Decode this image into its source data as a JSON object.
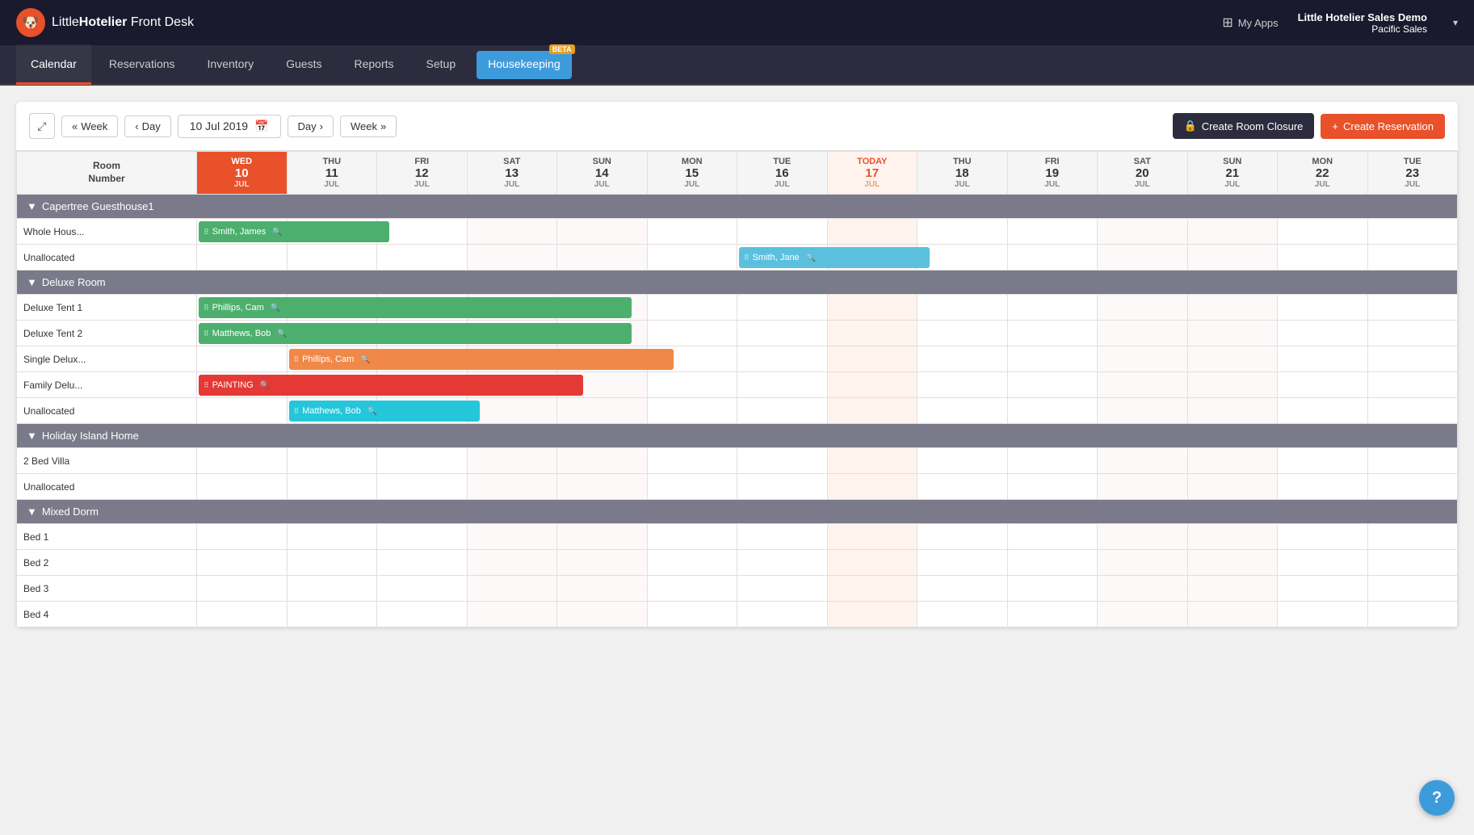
{
  "app": {
    "logo_text_light": "Little",
    "logo_text_bold": "Hotelier",
    "logo_subtext": "Front Desk",
    "logo_emoji": "🐶"
  },
  "nav_right": {
    "my_apps_label": "My Apps",
    "user_name": "Little Hotelier Sales Demo",
    "user_sub": "Pacific Sales"
  },
  "tabs": [
    {
      "label": "Calendar",
      "active": true
    },
    {
      "label": "Reservations",
      "active": false
    },
    {
      "label": "Inventory",
      "active": false
    },
    {
      "label": "Guests",
      "active": false
    },
    {
      "label": "Reports",
      "active": false
    },
    {
      "label": "Setup",
      "active": false
    },
    {
      "label": "Housekeeping",
      "active": false,
      "beta": true
    }
  ],
  "toolbar": {
    "week_back_label": "« Week",
    "day_back_label": "‹ Day",
    "current_date": "10 Jul 2019",
    "day_fwd_label": "Day »",
    "week_fwd_label": "Week »",
    "room_closure_label": "Create Room Closure",
    "create_reservation_label": "Create Reservation"
  },
  "calendar": {
    "room_number_header": "Room\nNumber",
    "days": [
      {
        "name": "WED",
        "num": "10",
        "month": "JUL",
        "type": "selected"
      },
      {
        "name": "THU",
        "num": "11",
        "month": "JUL",
        "type": "normal"
      },
      {
        "name": "FRI",
        "num": "12",
        "month": "JUL",
        "type": "normal"
      },
      {
        "name": "SAT",
        "num": "13",
        "month": "JUL",
        "type": "weekend"
      },
      {
        "name": "SUN",
        "num": "14",
        "month": "JUL",
        "type": "weekend"
      },
      {
        "name": "MON",
        "num": "15",
        "month": "JUL",
        "type": "normal"
      },
      {
        "name": "TUE",
        "num": "16",
        "month": "JUL",
        "type": "normal"
      },
      {
        "name": "TODAY",
        "num": "17",
        "month": "JUL",
        "type": "today"
      },
      {
        "name": "THU",
        "num": "18",
        "month": "JUL",
        "type": "normal"
      },
      {
        "name": "FRI",
        "num": "19",
        "month": "JUL",
        "type": "normal"
      },
      {
        "name": "SAT",
        "num": "20",
        "month": "JUL",
        "type": "weekend"
      },
      {
        "name": "SUN",
        "num": "21",
        "month": "JUL",
        "type": "weekend"
      },
      {
        "name": "MON",
        "num": "22",
        "month": "JUL",
        "type": "normal"
      },
      {
        "name": "TUE",
        "num": "23",
        "month": "JUL",
        "type": "normal"
      }
    ],
    "sections": [
      {
        "name": "Capertree Guesthouse1",
        "rooms": [
          {
            "name": "Whole Hous...",
            "reservations": [
              {
                "guest": "Smith, James",
                "color": "green",
                "start": 0,
                "span": 4
              }
            ]
          },
          {
            "name": "Unallocated",
            "reservations": [
              {
                "guest": "Smith, Jane",
                "color": "blue",
                "start": 6,
                "span": 4
              }
            ]
          }
        ]
      },
      {
        "name": "Deluxe Room",
        "rooms": [
          {
            "name": "Deluxe Tent 1",
            "reservations": [
              {
                "guest": "Phillips, Cam",
                "color": "green",
                "start": 0,
                "span": 9
              }
            ]
          },
          {
            "name": "Deluxe Tent 2",
            "reservations": [
              {
                "guest": "Matthews, Bob",
                "color": "green",
                "start": 0,
                "span": 9
              }
            ]
          },
          {
            "name": "Single Delux...",
            "reservations": [
              {
                "guest": "Phillips, Cam",
                "color": "orange",
                "start": 1,
                "span": 8
              }
            ]
          },
          {
            "name": "Family Delu...",
            "reservations": [
              {
                "guest": "PAINTING",
                "color": "red",
                "start": 0,
                "span": 8
              }
            ]
          },
          {
            "name": "Unallocated",
            "reservations": [
              {
                "guest": "Matthews, Bob",
                "color": "cyan",
                "start": 1,
                "span": 4
              }
            ]
          }
        ]
      },
      {
        "name": "Holiday Island Home",
        "rooms": [
          {
            "name": "2 Bed Villa",
            "reservations": []
          },
          {
            "name": "Unallocated",
            "reservations": []
          }
        ]
      },
      {
        "name": "Mixed Dorm",
        "rooms": [
          {
            "name": "Bed 1",
            "reservations": []
          },
          {
            "name": "Bed 2",
            "reservations": []
          },
          {
            "name": "Bed 3",
            "reservations": []
          },
          {
            "name": "Bed 4",
            "reservations": []
          }
        ]
      }
    ]
  },
  "help": {
    "label": "?"
  }
}
